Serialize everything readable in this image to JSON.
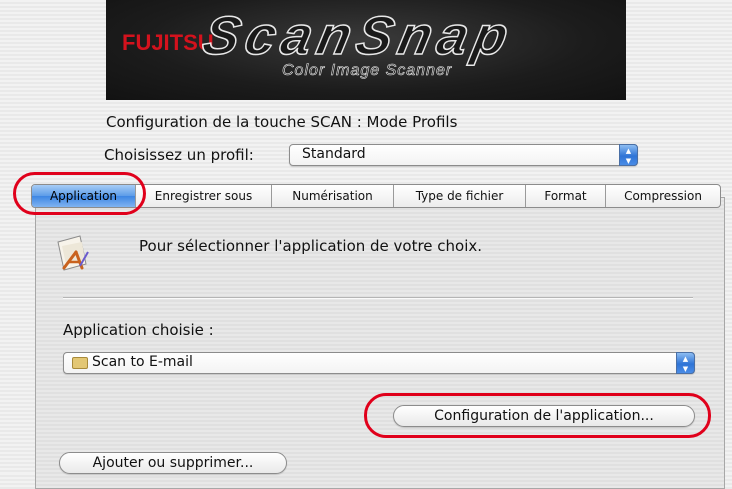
{
  "banner": {
    "brand": "FUJITSU",
    "product": "ScanSnap",
    "subtitle": "Color Image Scanner"
  },
  "heading": "Configuration de la touche SCAN : Mode Profils",
  "profile": {
    "label": "Choisissez un profil:",
    "value": "Standard"
  },
  "tabs": [
    {
      "label": "Application",
      "active": true
    },
    {
      "label": "Enregistrer sous"
    },
    {
      "label": "Numérisation"
    },
    {
      "label": "Type de fichier"
    },
    {
      "label": "Format"
    },
    {
      "label": "Compression"
    }
  ],
  "panel": {
    "info_text": "Pour sélectionner l'application de votre choix.",
    "app_label": "Application choisie :",
    "app_value": "Scan to E-mail",
    "config_button": "Configuration de l'application...",
    "add_remove_button": "Ajouter ou supprimer..."
  },
  "colors": {
    "highlight": "#e0001b",
    "active_tab": "#5c9ce8",
    "brand_red": "#d4121d"
  }
}
